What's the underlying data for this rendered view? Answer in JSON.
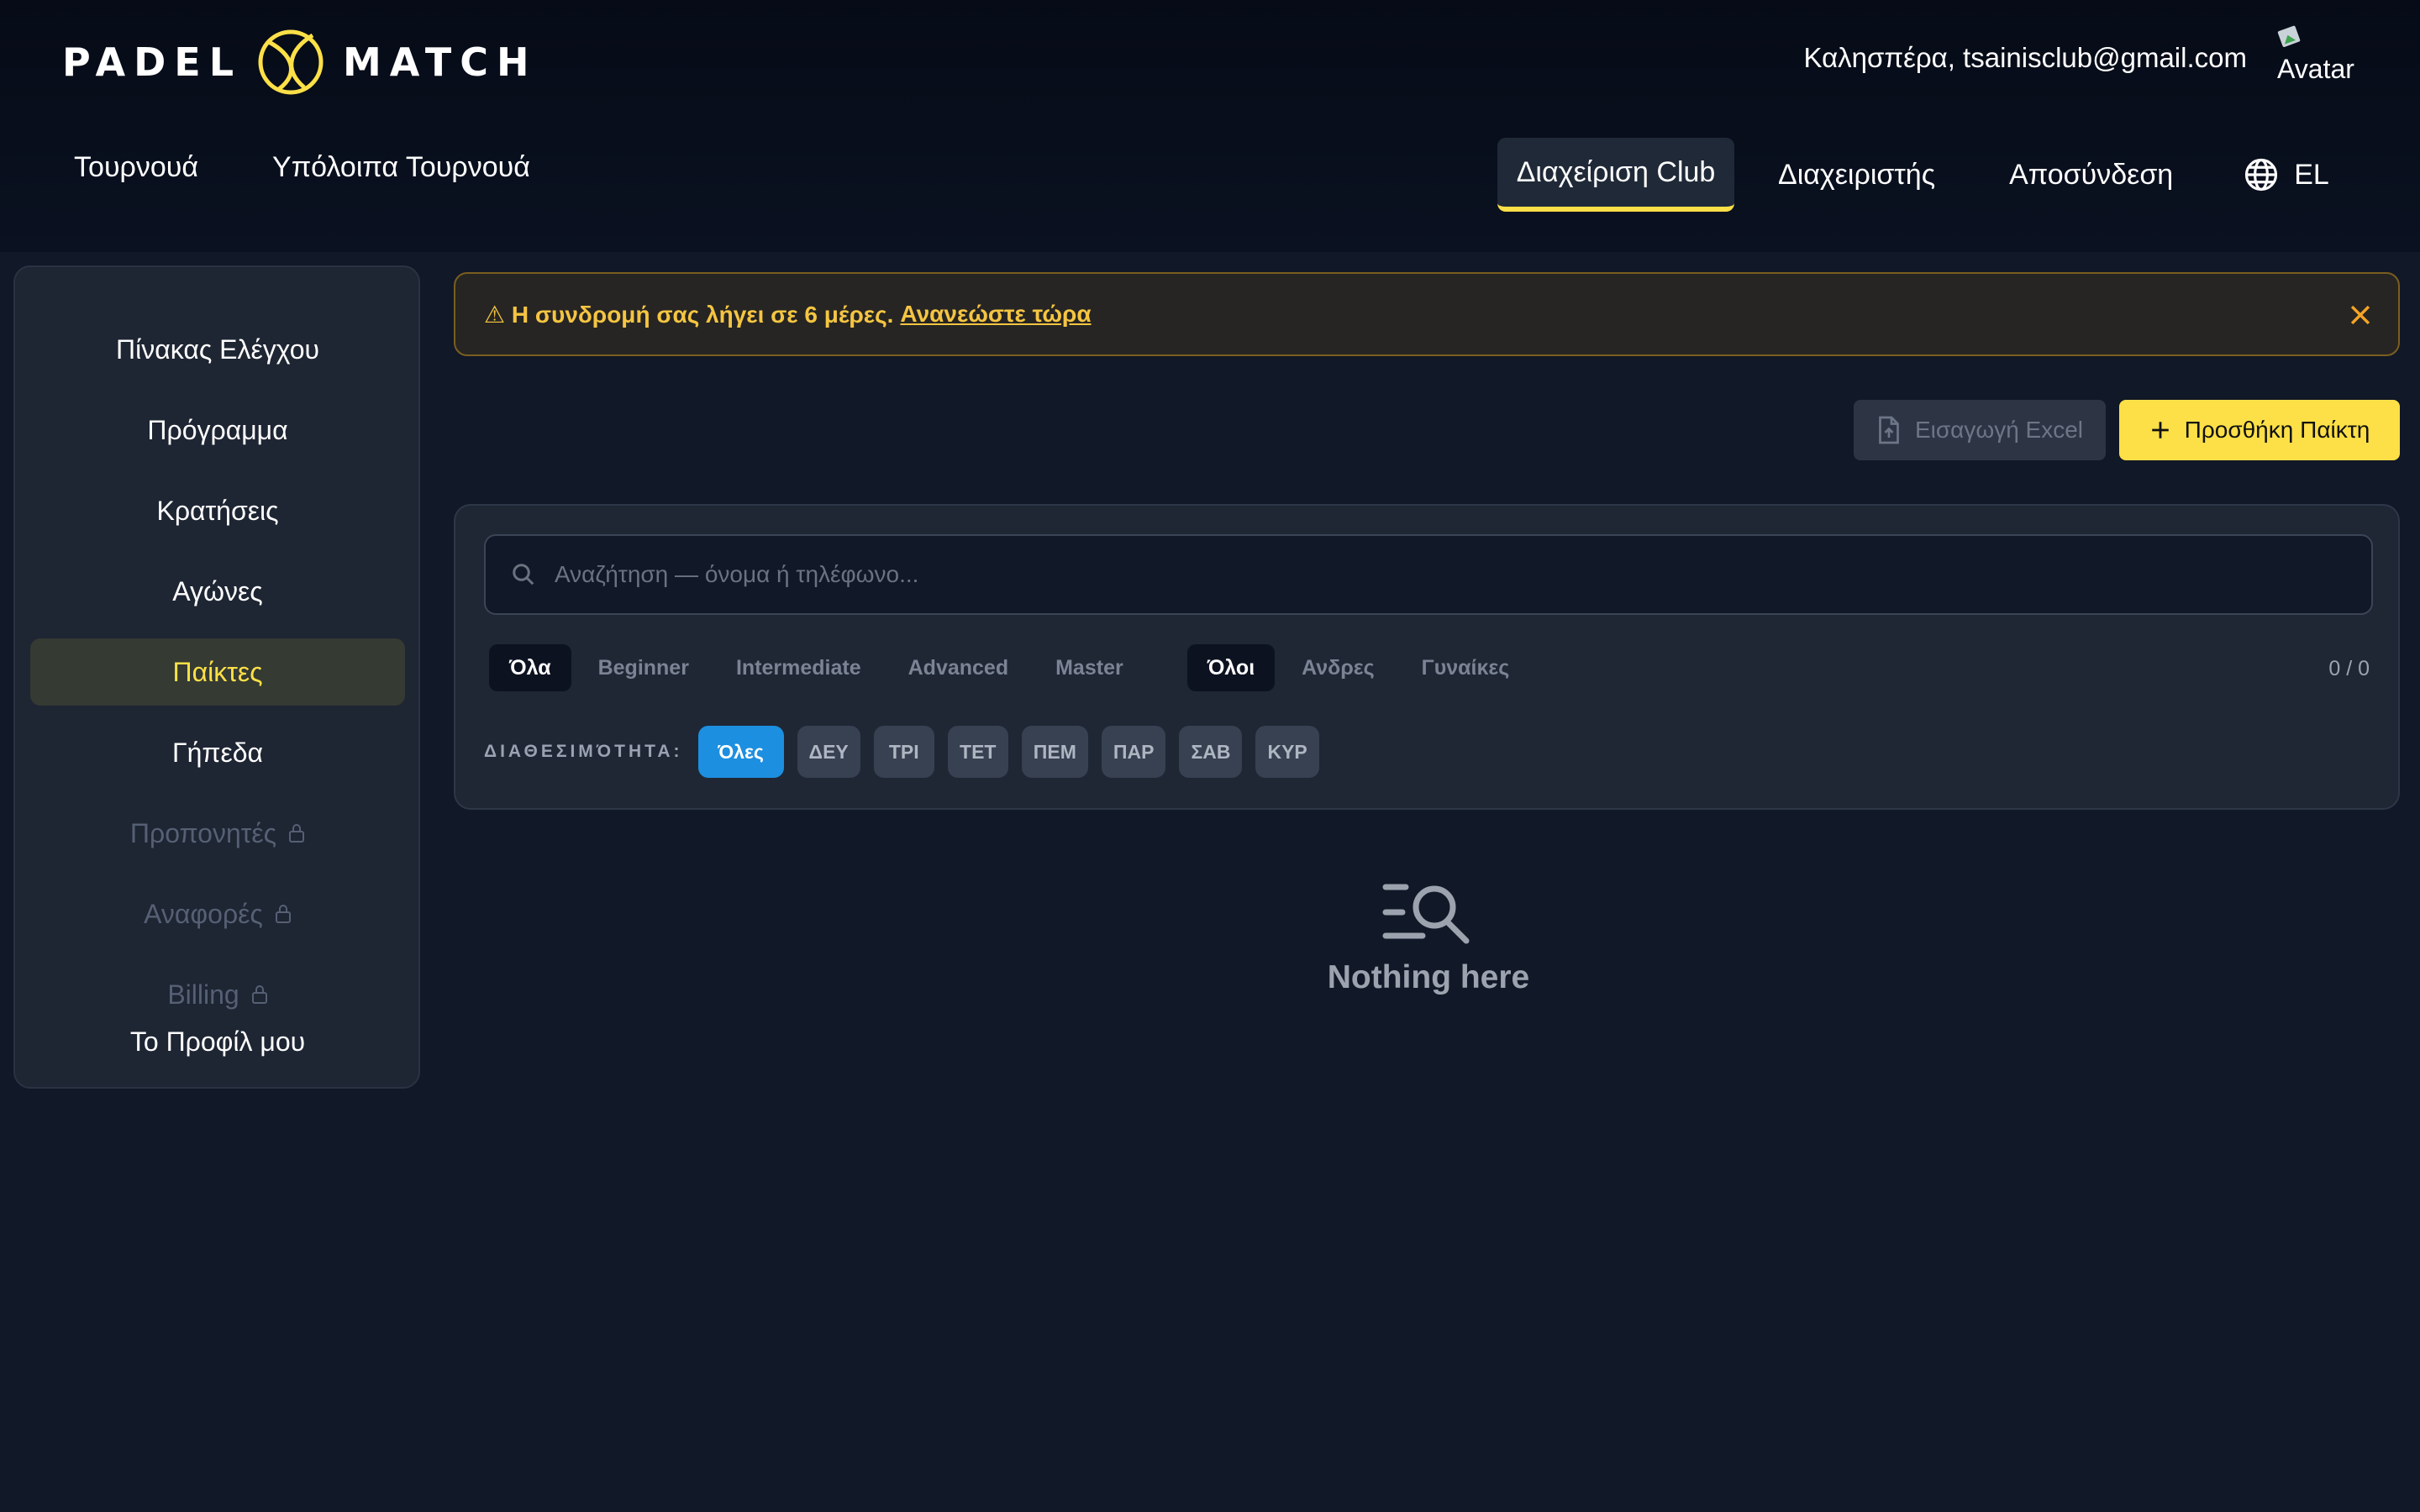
{
  "header": {
    "logo_left": "PADEL",
    "logo_right": "MATCH",
    "greeting": "Καλησπέρα, tsainisclub@gmail.com",
    "avatar_alt": "Avatar",
    "nav_left": [
      "Τουρνουά",
      "Υπόλοιπα Τουρνουά"
    ],
    "nav_right": {
      "club_admin": "Διαχείριση Club",
      "admin": "Διαχειριστής",
      "logout": "Αποσύνδεση",
      "language": "EL"
    },
    "accent_color": "#fde047"
  },
  "sidebar": {
    "items": [
      {
        "label": "Πίνακας Ελέγχου",
        "active": false,
        "locked": false
      },
      {
        "label": "Πρόγραμμα",
        "active": false,
        "locked": false
      },
      {
        "label": "Κρατήσεις",
        "active": false,
        "locked": false
      },
      {
        "label": "Αγώνες",
        "active": false,
        "locked": false
      },
      {
        "label": "Παίκτες",
        "active": true,
        "locked": false
      },
      {
        "label": "Γήπεδα",
        "active": false,
        "locked": false
      },
      {
        "label": "Προπονητές",
        "active": false,
        "locked": true
      },
      {
        "label": "Αναφορές",
        "active": false,
        "locked": true
      },
      {
        "label": "Billing",
        "active": false,
        "locked": true
      },
      {
        "label": "Το Προφίλ μου",
        "active": false,
        "locked": false
      }
    ]
  },
  "banner": {
    "icon": "warning-icon",
    "text": "⚠ Η συνδρομή σας λήγει σε 6 μέρες.",
    "link": "Ανανεώστε τώρα"
  },
  "toolbar": {
    "import_label": "Εισαγωγή Excel",
    "add_label": "Προσθήκη Παίκτη"
  },
  "search": {
    "placeholder": "Αναζήτηση — όνομα ή τηλέφωνο...",
    "value": ""
  },
  "level_filters": [
    "Όλα",
    "Beginner",
    "Intermediate",
    "Advanced",
    "Master"
  ],
  "gender_filters": [
    "Όλοι",
    "Ανδρες",
    "Γυναίκες"
  ],
  "count": "0 / 0",
  "availability": {
    "label": "ΔΙΑΘΕΣΙΜΌΤΗΤΑ:",
    "days": [
      "Όλες",
      "ΔΕΥ",
      "ΤΡΙ",
      "ΤΕΤ",
      "ΠΕΜ",
      "ΠΑΡ",
      "ΣΑΒ",
      "ΚΥΡ"
    ]
  },
  "empty_state": {
    "icon": "search-list-icon",
    "text": "Nothing here"
  }
}
